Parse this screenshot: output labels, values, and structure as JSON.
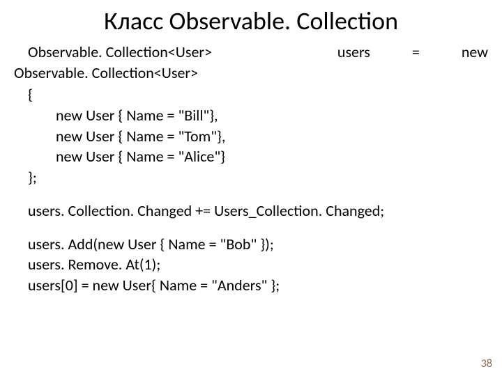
{
  "title": "Класс Observable. Collection",
  "decl": {
    "type": "Observable. Collection<User>",
    "var": "users",
    "eq": "=",
    "new": "new",
    "type2": "Observable. Collection<User>"
  },
  "brace_open": "{",
  "items": [
    "new User { Name = \"Bill\"},",
    "new User { Name = \"Tom\"},",
    "new User { Name = \"Alice\"}"
  ],
  "brace_close": "};",
  "line_changed": "users. Collection. Changed += Users_Collection. Changed;",
  "line_add": "users. Add(new User { Name = \"Bob\" });",
  "line_remove": "users. Remove. At(1);",
  "line_index": "users[0] = new User{ Name = \"Anders\" };",
  "page": "38"
}
